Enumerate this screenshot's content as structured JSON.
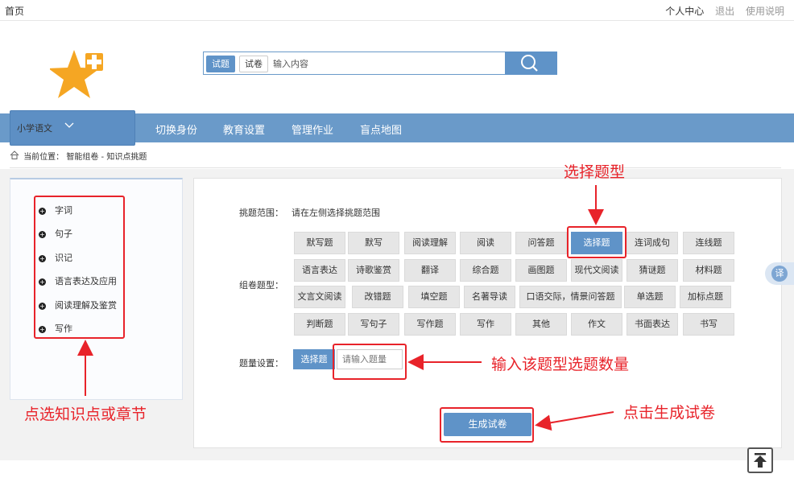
{
  "topbar": {
    "home": "首页",
    "personal_center": "个人中心",
    "logout": "退出",
    "help": "使用说明"
  },
  "search": {
    "tab_question": "试题",
    "tab_paper": "试卷",
    "placeholder": "输入内容",
    "button_icon": "search-icon"
  },
  "nav": {
    "subject": "小学语文",
    "items": [
      "切换身份",
      "教育设置",
      "管理作业",
      "盲点地图"
    ]
  },
  "breadcrumb": {
    "label": "当前位置：",
    "path": "智能组卷 - 知识点挑题"
  },
  "knowledge_tree": [
    "字词",
    "句子",
    "识记",
    "语言表达及应用",
    "阅读理解及鉴赏",
    "写作"
  ],
  "main": {
    "scope_label": "挑题范围：",
    "scope_value": "请在左侧选择挑题范围",
    "type_label": "组卷题型：",
    "count_label": "题量设置：",
    "count_button": "选择题",
    "count_placeholder": "请输入题量",
    "generate_button": "生成试卷",
    "question_types": [
      [
        "默写题",
        "默写",
        "阅读理解",
        "阅读",
        "问答题",
        "选择题",
        "连词成句",
        "连线题"
      ],
      [
        "语言表达",
        "诗歌鉴赏",
        "翻译",
        "综合题",
        "画图题",
        "现代文阅读",
        "猜谜题",
        "材料题"
      ],
      [
        "文言文阅读",
        "改错题",
        "填空题",
        "名著导读",
        "口语交际，情景问答题",
        "单选题",
        "加标点题"
      ],
      [
        "判断题",
        "写句子",
        "写作题",
        "写作",
        "其他",
        "作文",
        "书面表达",
        "书写"
      ]
    ],
    "selected_type": "选择题"
  },
  "annotations": {
    "select_type": "选择题型",
    "input_count": "输入该题型选题数量",
    "pick_knowledge": "点选知识点或章节",
    "click_generate": "点击生成试卷"
  },
  "side": {
    "translate": "译"
  },
  "colors": {
    "primary": "#6a9ac9",
    "button": "#5f93c8",
    "annotation": "#e8232a",
    "logo": "#f5a623"
  }
}
